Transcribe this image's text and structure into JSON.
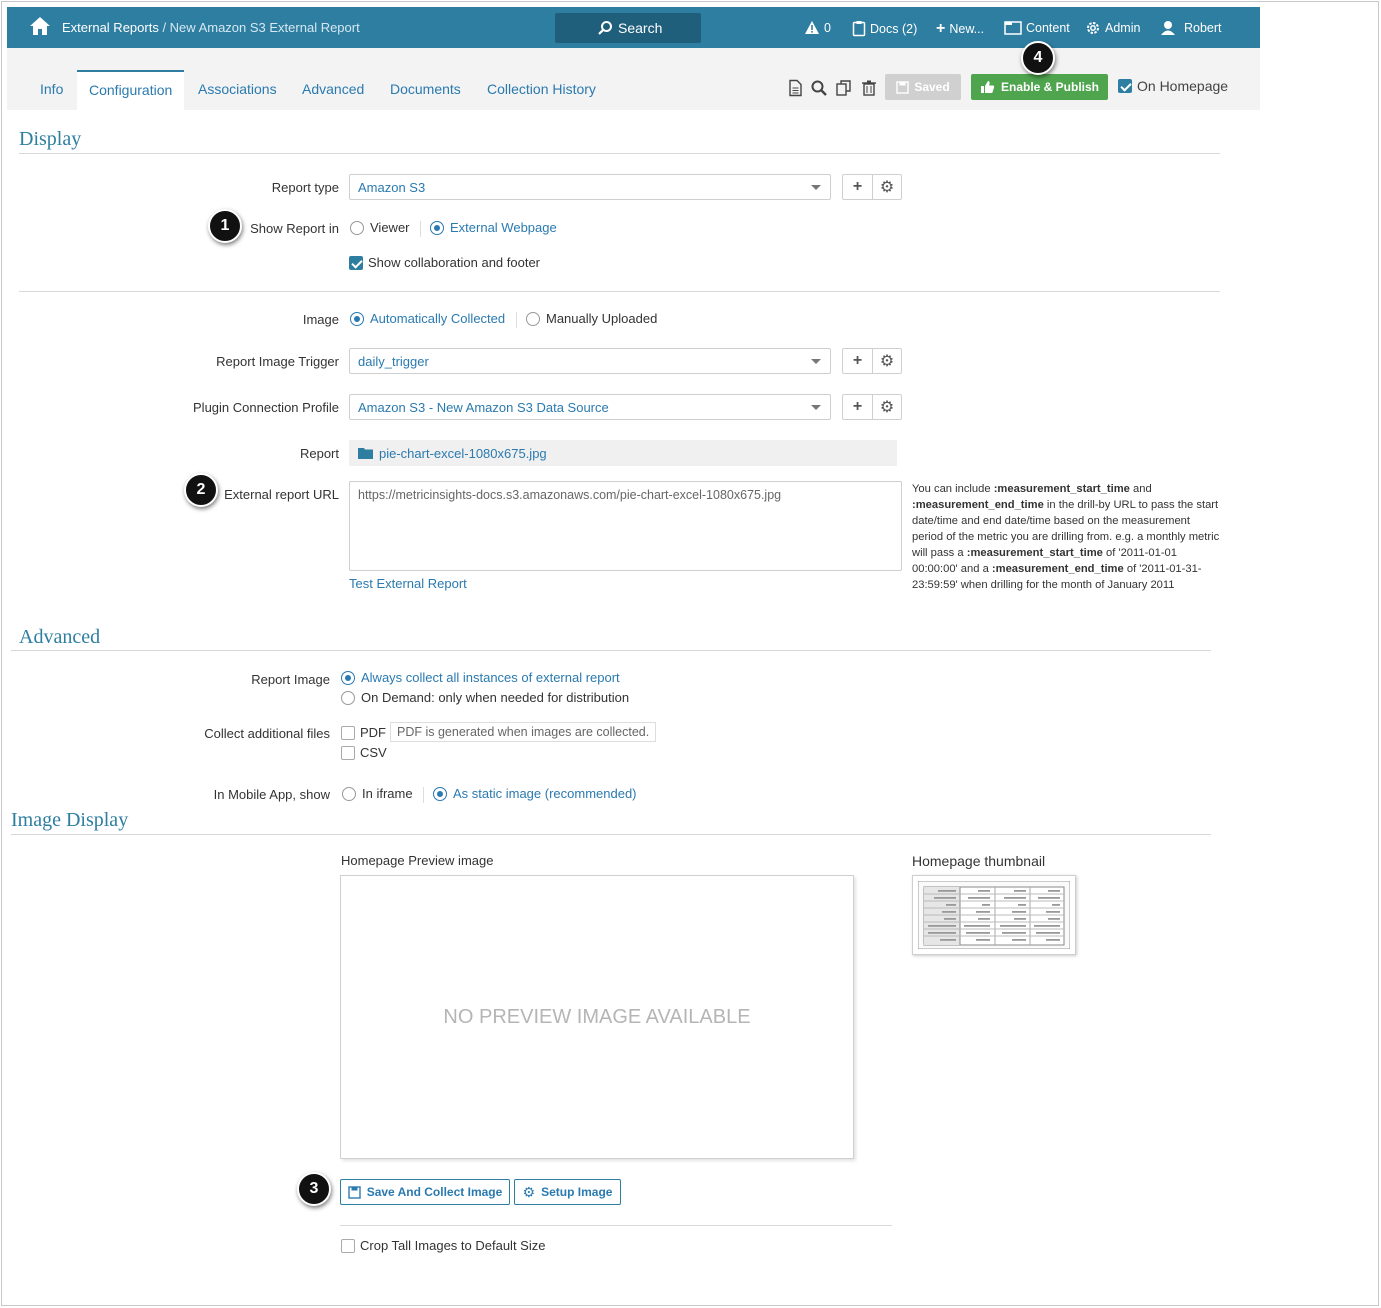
{
  "header": {
    "breadcrumb_root": "External Reports",
    "breadcrumb_sep": " / ",
    "breadcrumb_current": "New Amazon S3 External Report",
    "search_label": "Search",
    "alerts_count": "0",
    "docs_label": "Docs (2)",
    "new_label": "New...",
    "content_label": "Content",
    "admin_label": "Admin",
    "user_label": "Robert"
  },
  "tabs": [
    {
      "label": "Info"
    },
    {
      "label": "Configuration"
    },
    {
      "label": "Associations"
    },
    {
      "label": "Advanced"
    },
    {
      "label": "Documents"
    },
    {
      "label": "Collection History"
    }
  ],
  "toolbar": {
    "saved_label": "Saved",
    "publish_label": "Enable & Publish",
    "on_homepage_label": "On Homepage"
  },
  "display": {
    "title": "Display",
    "report_type_label": "Report type",
    "report_type_value": "Amazon S3",
    "show_report_in_label": "Show Report in",
    "viewer_label": "Viewer",
    "external_webpage_label": "External Webpage",
    "collab_label": "Show collaboration and footer",
    "image_label": "Image",
    "auto_collected_label": "Automatically Collected",
    "manual_uploaded_label": "Manually Uploaded",
    "trigger_label": "Report Image Trigger",
    "trigger_value": "daily_trigger",
    "plugin_label": "Plugin Connection Profile",
    "plugin_value": "Amazon S3 - New Amazon S3 Data Source",
    "report_label": "Report",
    "report_file": "pie-chart-excel-1080x675.jpg",
    "url_label": "External report URL",
    "url_value": "https://metricinsights-docs.s3.amazonaws.com/pie-chart-excel-1080x675.jpg",
    "test_link": "Test External Report",
    "help_1": "You can include ",
    "help_start": ":measurement_start_time",
    "help_2": " and ",
    "help_end": ":measurement_end_time",
    "help_3": " in the drill-by URL to pass the start date/time and end date/time based on the measurement period of the metric you are drilling from. e.g. a monthly metric will pass a ",
    "help_start2": ":measurement_start_time",
    "help_4": " of '2011-01-01 00:00:00' and a ",
    "help_end2": ":measurement_end_time",
    "help_5": " of '2011-01-31-23:59:59' when drilling for the month of January 2011"
  },
  "advanced": {
    "title": "Advanced",
    "report_image_label": "Report Image",
    "always_label": "Always collect all instances of external report",
    "on_demand_label": "On Demand: only when needed for distribution",
    "additional_label": "Collect additional files",
    "pdf_label": "PDF",
    "pdf_note": "PDF is generated when images are collected.",
    "csv_label": "CSV",
    "mobile_label": "In Mobile App, show",
    "iframe_label": "In iframe",
    "static_label": "As static image (recommended)"
  },
  "image_display": {
    "title": "Image Display",
    "preview_label": "Homepage Preview image",
    "no_preview": "NO PREVIEW IMAGE AVAILABLE",
    "thumbnail_label": "Homepage thumbnail",
    "save_collect_label": "Save And Collect Image",
    "setup_label": "Setup Image",
    "crop_label": "Crop Tall Images to Default Size"
  },
  "badges": [
    "1",
    "2",
    "3",
    "4"
  ],
  "colors": {
    "brand": "#2e7ea1",
    "link": "#2a7ab0",
    "publish": "#4ea54e"
  }
}
